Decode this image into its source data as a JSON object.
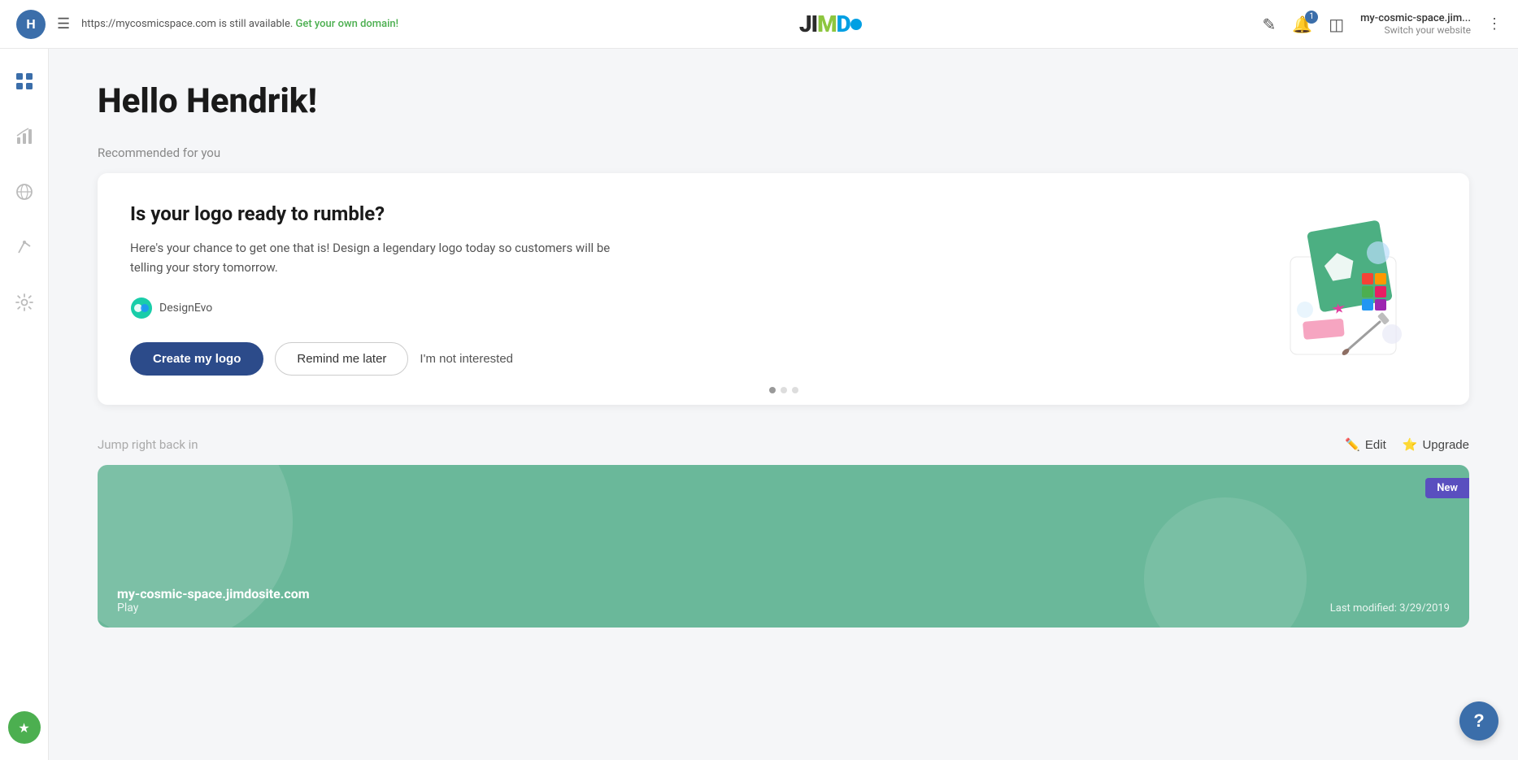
{
  "header": {
    "avatar_letter": "H",
    "domain_notice": "https://mycosmicspace.com is still available.",
    "domain_cta": "Get your own domain!",
    "logo_parts": {
      "ji": "JI",
      "m": "M",
      "do": "DO"
    },
    "notification_count": "1",
    "site_name": "my-cosmic-space.jim...",
    "switch_text": "Switch your website"
  },
  "sidebar": {
    "icons": [
      "grid",
      "chart",
      "compass",
      "send",
      "gear"
    ]
  },
  "main": {
    "greeting": "Hello Hendrik!",
    "recommended_label": "Recommended for you",
    "card": {
      "title": "Is your logo ready to rumble?",
      "description": "Here's your chance to get one that is! Design a legendary logo today so customers will be telling your story tomorrow.",
      "partner_label": "DesignEvo",
      "btn_primary": "Create my logo",
      "btn_outline": "Remind me later",
      "btn_text": "I'm not interested"
    },
    "jump_label": "Jump right back in",
    "edit_label": "Edit",
    "upgrade_label": "Upgrade",
    "website": {
      "name": "my-cosmic-space.jimdosite.com",
      "play": "Play",
      "modified": "Last modified: 3/29/2019",
      "badge": "New"
    }
  },
  "help_btn": "?"
}
